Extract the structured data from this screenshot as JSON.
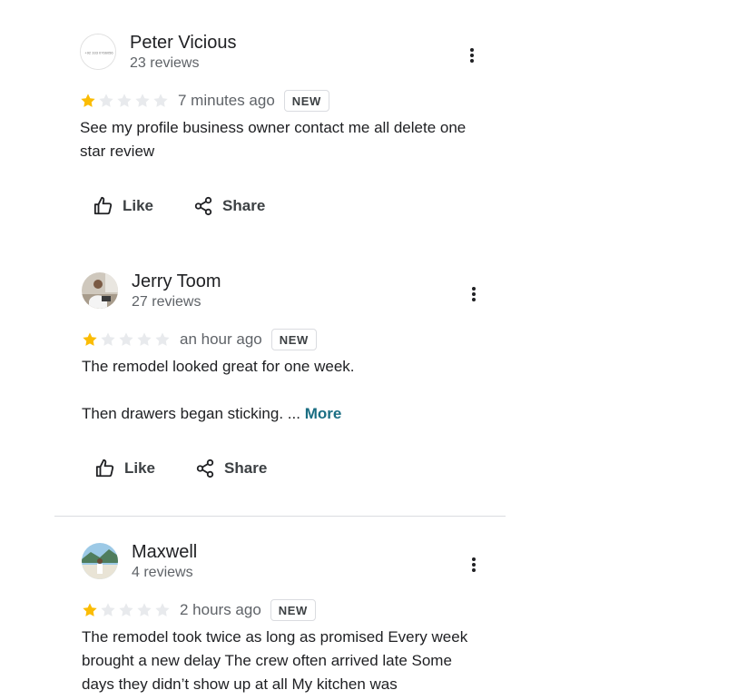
{
  "reviews": [
    {
      "name": "Peter Vicious",
      "count": "23 reviews",
      "rating": 1,
      "max_rating": 5,
      "time": "7 minutes ago",
      "badge": "NEW",
      "text": [
        "See my profile business owner contact me all delete one star review"
      ],
      "avatar_text": "+92 333 0766056",
      "like_label": "Like",
      "share_label": "Share"
    },
    {
      "name": "Jerry Toom",
      "count": "27 reviews",
      "rating": 1,
      "max_rating": 5,
      "time": "an hour ago",
      "badge": "NEW",
      "text": [
        "The remodel looked great for one week.",
        "Then drawers began sticking. ..."
      ],
      "more_label": "More",
      "like_label": "Like",
      "share_label": "Share"
    },
    {
      "name": "Maxwell",
      "count": "4 reviews",
      "rating": 1,
      "max_rating": 5,
      "time": "2 hours ago",
      "badge": "NEW",
      "text": [
        "The remodel took twice as long as promised Every week brought a new delay The crew often arrived late Some days they didn’t show up at all My kitchen was"
      ]
    }
  ],
  "colors": {
    "star_filled": "#fbbc04",
    "star_empty": "#e8eaed",
    "link": "#1a6e83",
    "divider": "#dadce0"
  }
}
